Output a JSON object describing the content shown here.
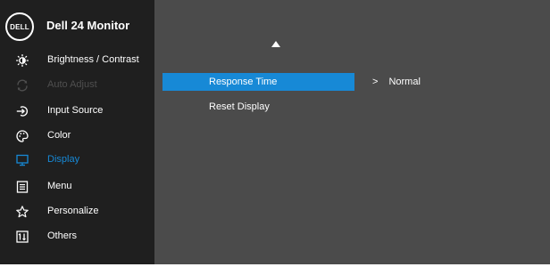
{
  "header": {
    "logo_text": "DELL",
    "title": "Dell 24 Monitor"
  },
  "menu": {
    "items": [
      {
        "label": "Brightness / Contrast",
        "icon": "brightness-icon",
        "state": "normal"
      },
      {
        "label": "Auto Adjust",
        "icon": "auto-adjust-icon",
        "state": "disabled"
      },
      {
        "label": "Input Source",
        "icon": "input-source-icon",
        "state": "normal"
      },
      {
        "label": "Color",
        "icon": "color-palette-icon",
        "state": "normal"
      },
      {
        "label": "Display",
        "icon": "display-icon",
        "state": "active"
      },
      {
        "label": "Menu",
        "icon": "menu-icon",
        "state": "normal"
      },
      {
        "label": "Personalize",
        "icon": "star-icon",
        "state": "normal"
      },
      {
        "label": "Others",
        "icon": "others-icon",
        "state": "normal"
      }
    ]
  },
  "submenu": {
    "options": [
      {
        "label": "Response Time",
        "selected": true
      },
      {
        "label": "Reset Display",
        "selected": false
      }
    ],
    "value_chevron": ">",
    "value": "Normal"
  },
  "colors": {
    "sidebar_bg": "#1f1f1f",
    "content_bg": "#4b4b4b",
    "accent": "#1789d6",
    "disabled_text": "#4f4f4f"
  }
}
